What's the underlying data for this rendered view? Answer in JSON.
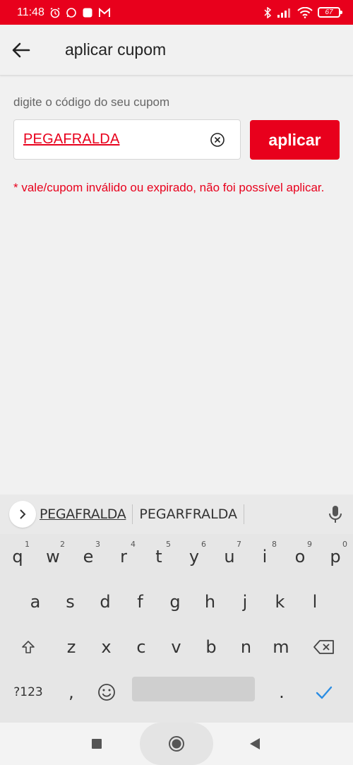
{
  "status": {
    "time": "11:48",
    "battery": "67"
  },
  "appbar": {
    "title": "aplicar cupom"
  },
  "form": {
    "hint": "digite o código do seu cupom",
    "coupon_value": "PEGAFRALDA",
    "apply_label": "aplicar",
    "error": "* vale/cupom inválido ou expirado, não foi possível aplicar."
  },
  "keyboard": {
    "suggestions": [
      "PEGAFRALDA",
      "PEGARFRALDA"
    ],
    "row1": [
      {
        "k": "q",
        "n": "1"
      },
      {
        "k": "w",
        "n": "2"
      },
      {
        "k": "e",
        "n": "3"
      },
      {
        "k": "r",
        "n": "4"
      },
      {
        "k": "t",
        "n": "5"
      },
      {
        "k": "y",
        "n": "6"
      },
      {
        "k": "u",
        "n": "7"
      },
      {
        "k": "i",
        "n": "8"
      },
      {
        "k": "o",
        "n": "9"
      },
      {
        "k": "p",
        "n": "0"
      }
    ],
    "row2": [
      "a",
      "s",
      "d",
      "f",
      "g",
      "h",
      "j",
      "k",
      "l"
    ],
    "row3": [
      "z",
      "x",
      "c",
      "v",
      "b",
      "n",
      "m"
    ],
    "symbols_label": "?123",
    "comma": ",",
    "period": "."
  },
  "colors": {
    "brand": "#e8001c",
    "background": "#f1f1f1",
    "check": "#2b8de3"
  }
}
